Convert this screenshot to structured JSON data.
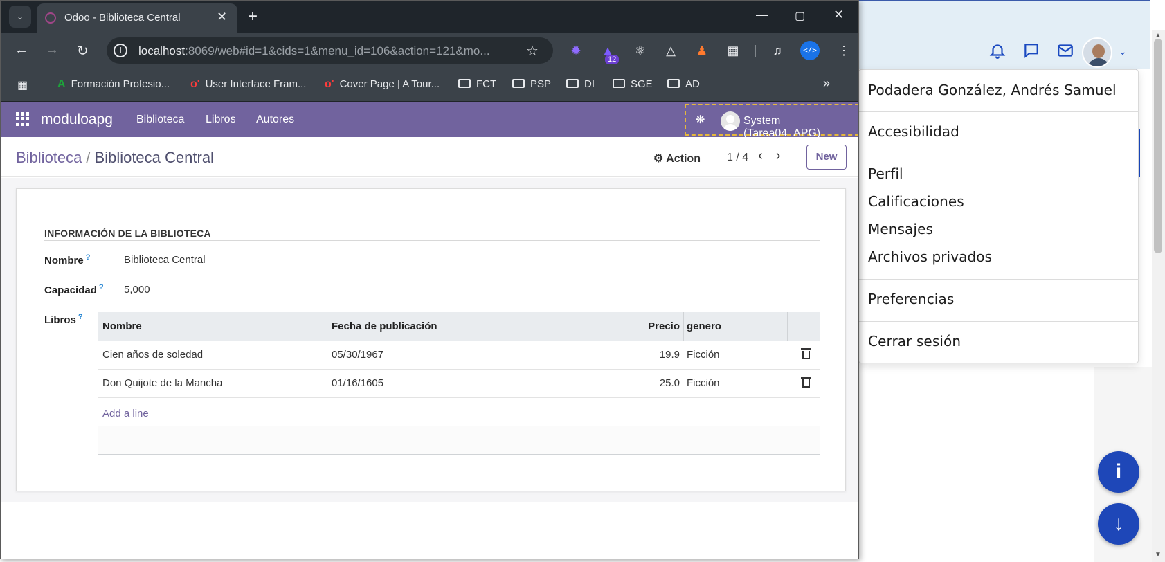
{
  "browser": {
    "tab_title": "Odoo - Biblioteca Central",
    "url_host": "localhost",
    "url_rest": ":8069/web#id=1&cids=1&menu_id=106&action=121&mo...",
    "ext_badge": "12",
    "dev_ext_label": "</>",
    "bookmarks": [
      "Formación Profesio...",
      "User Interface Fram...",
      "Cover Page | A Tour...",
      "FCT",
      "PSP",
      "DI",
      "SGE",
      "AD"
    ]
  },
  "odoo": {
    "brand": "moduloapg",
    "menus": [
      "Biblioteca",
      "Libros",
      "Autores"
    ],
    "user": "System (Tarea04_APG)",
    "breadcrumb_parent": "Biblioteca",
    "breadcrumb_sep": "/",
    "breadcrumb_current": "Biblioteca Central",
    "action_label": "Action",
    "pager": "1 / 4",
    "new_label": "New",
    "group_title": "INFORMACIÓN DE LA BIBLIOTECA",
    "fields": {
      "nombre_label": "Nombre",
      "nombre_value": "Biblioteca Central",
      "capacidad_label": "Capacidad",
      "capacidad_value": "5,000",
      "libros_label": "Libros",
      "help_mark": "?"
    },
    "table": {
      "columns": [
        "Nombre",
        "Fecha de publicación",
        "Precio",
        "genero"
      ],
      "rows": [
        {
          "nombre": "Cien años de soledad",
          "fecha": "05/30/1967",
          "precio": "19.9",
          "genero": "Ficción"
        },
        {
          "nombre": "Don Quijote de la Mancha",
          "fecha": "01/16/1605",
          "precio": "25.0",
          "genero": "Ficción"
        }
      ],
      "add_line": "Add a line"
    }
  },
  "user_menu": {
    "name": "Podadera González, Andrés Samuel",
    "items": [
      "Accesibilidad",
      "Perfil",
      "Calificaciones",
      "Mensajes",
      "Archivos privados",
      "Preferencias",
      "Cerrar sesión"
    ]
  },
  "colors": {
    "odoo_primary": "#71639e",
    "fab_blue": "#1e47b8",
    "browser_dark": "#3b4249"
  }
}
